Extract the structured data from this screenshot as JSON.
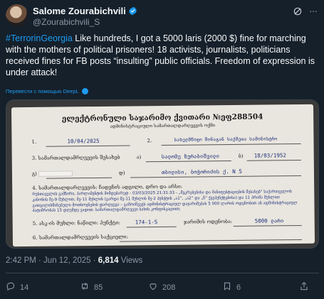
{
  "author": {
    "name": "Salome Zourabichvili",
    "handle": "@Zourabichvili_S"
  },
  "tweet": {
    "hashtag": "#TerrorinGeorgia",
    "text": " Like hundreds, I got a 5000 laris (2000 $) fine for marching with the mothers of political prisoners!  18 activists, journalists, politicians received fines for FB posts “insulting” public officials. Freedom of expression is under attack!",
    "translate_label": "Перевести с помощью DeepL"
  },
  "document": {
    "title": "ელექტრონული საჯარიმო ქვითარი №ეფ288504",
    "subtitle": "ადმინისტრაციული სამართალდარღვევის ოქმი",
    "row1_num": "1.",
    "date": "10/04/2025",
    "row2_num": "2.",
    "authority": "სახელმწიფო შინაგან საქმეთა სამინისტრო",
    "row3_label": "3. სამართალდამრღვევის შესახებ",
    "row3_a": "ა)",
    "offender": "სალომე ზურაბიშვილი",
    "row3_b": "ბ)",
    "birth_date": "18/03/1952",
    "row3_g": "გ)",
    "row3_d": "დ)",
    "address": "თბილისი, ბოჭორიძის ქ. N 5",
    "row4_label": "4. სამართალდარღვევის: ჩადენის ადგილი, დრო და არსი:",
    "row4_text": "რუსთაველის გამზირი, პარლამენტის მიმდებარედ - 03/03/2025 21:31:33 - „შეკრებებისა და მანიფესტაციების შესახებ“ საქართველოს კანონის მე-9 მუხლით, მე-11 მუხლის (გარდა მე-11 მუხლის მე-2 პუნქტის „ა1“, „ა2“ და „ზ“ ქვეპუნქტებისა) და 11 პრიმა მუხლით გათვალისწინებული მოთხოვნების დარღვევა – გამოიწვევს ადმინისტრაციულ დაჯარიმებას 5 000 ლარის ოდენობით ან ადმინისტრაციულ პატიმრობას 15 დღემდე ვადით. სამართალდამრღვევი სახის კონფისკაციით;",
    "row5_label": "5. ასკ-ის მუხლი: ნაწილი: პუნქტი:",
    "article": "174-1-5",
    "fine_label": "ჯარიმის ოდენობა:",
    "fine": "5000 ლარი",
    "row6_label": "6. სამართალდამრღვევის საქციელი:"
  },
  "meta": {
    "time": "2:42 PM · Jun 12, 2025 · ",
    "views": "6,814",
    "views_label": " Views"
  },
  "actions": {
    "replies": "14",
    "reposts": "85",
    "likes": "208",
    "bookmarks": "6"
  },
  "colors": {
    "background": "#15202b",
    "accent": "#1d9bf0",
    "muted": "#8b98a5",
    "text": "#f7f9f9"
  }
}
